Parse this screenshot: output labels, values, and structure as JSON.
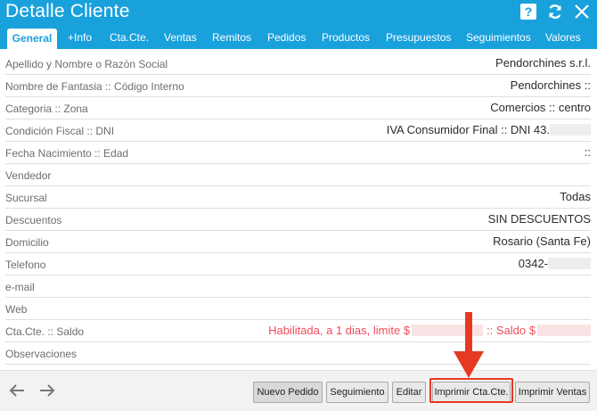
{
  "window": {
    "title": "Detalle Cliente"
  },
  "header_icons": [
    "help-icon",
    "refresh-icon",
    "close-icon"
  ],
  "tabs": [
    {
      "label": "General",
      "active": true
    },
    {
      "label": "+Info"
    },
    {
      "label": "Cta.Cte."
    },
    {
      "label": "Ventas"
    },
    {
      "label": "Remitos"
    },
    {
      "label": "Pedidos"
    },
    {
      "label": "Productos"
    },
    {
      "label": "Presupuestos"
    },
    {
      "label": "Seguimientos"
    },
    {
      "label": "Valores"
    }
  ],
  "fields": [
    {
      "label": "Apellido y Nombre o Razón Social",
      "value": "Pendorchines s.r.l."
    },
    {
      "label": "Nombre de Fantasia :: Código Interno",
      "value": "Pendorchines ::"
    },
    {
      "label": "Categoria :: Zona",
      "value": "Comercios :: centro"
    },
    {
      "label": "Condición Fiscal :: DNI",
      "value": "IVA Consumidor Final :: DNI 43."
    },
    {
      "label": "Fecha Nacimiento :: Edad",
      "value": "::"
    },
    {
      "label": "Vendedor",
      "value": ""
    },
    {
      "label": "Sucursal",
      "value": "Todas"
    },
    {
      "label": "Descuentos",
      "value": "SIN DESCUENTOS"
    },
    {
      "label": "Domicilio",
      "value": "Rosario (Santa Fe)"
    },
    {
      "label": "Telefono",
      "value": "0342-"
    },
    {
      "label": "e-mail",
      "value": ""
    },
    {
      "label": "Web",
      "value": ""
    },
    {
      "label": "Cta.Cte. :: Saldo",
      "value_part1": "Habilitada, a 1 dias, limite $",
      "value_part2": ":: Saldo $"
    },
    {
      "label": "Observaciones",
      "value": ""
    }
  ],
  "footer": {
    "buttons": [
      "Nuevo Pedido",
      "Seguimiento",
      "Editar",
      "Imprimir Cta.Cte.",
      "Imprimir Ventas"
    ]
  },
  "colors": {
    "header": "#19a1dc",
    "accent_red": "#ef4d5a",
    "highlight": "#e53a21"
  }
}
